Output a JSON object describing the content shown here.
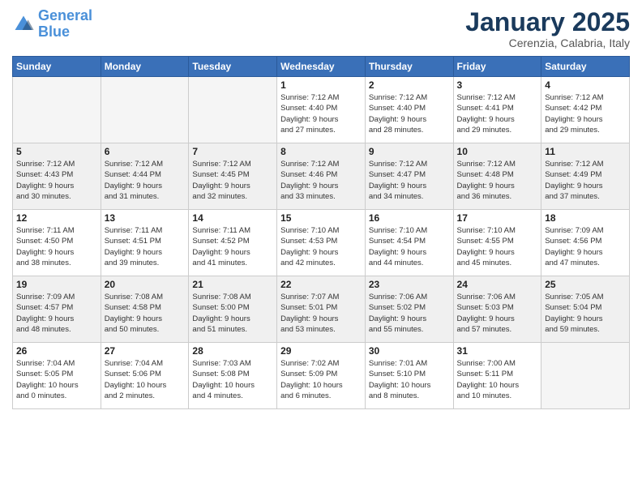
{
  "header": {
    "logo_line1": "General",
    "logo_line2": "Blue",
    "main_title": "January 2025",
    "subtitle": "Cerenzia, Calabria, Italy"
  },
  "weekdays": [
    "Sunday",
    "Monday",
    "Tuesday",
    "Wednesday",
    "Thursday",
    "Friday",
    "Saturday"
  ],
  "weeks": [
    [
      {
        "day": "",
        "info": ""
      },
      {
        "day": "",
        "info": ""
      },
      {
        "day": "",
        "info": ""
      },
      {
        "day": "1",
        "info": "Sunrise: 7:12 AM\nSunset: 4:40 PM\nDaylight: 9 hours\nand 27 minutes."
      },
      {
        "day": "2",
        "info": "Sunrise: 7:12 AM\nSunset: 4:40 PM\nDaylight: 9 hours\nand 28 minutes."
      },
      {
        "day": "3",
        "info": "Sunrise: 7:12 AM\nSunset: 4:41 PM\nDaylight: 9 hours\nand 29 minutes."
      },
      {
        "day": "4",
        "info": "Sunrise: 7:12 AM\nSunset: 4:42 PM\nDaylight: 9 hours\nand 29 minutes."
      }
    ],
    [
      {
        "day": "5",
        "info": "Sunrise: 7:12 AM\nSunset: 4:43 PM\nDaylight: 9 hours\nand 30 minutes."
      },
      {
        "day": "6",
        "info": "Sunrise: 7:12 AM\nSunset: 4:44 PM\nDaylight: 9 hours\nand 31 minutes."
      },
      {
        "day": "7",
        "info": "Sunrise: 7:12 AM\nSunset: 4:45 PM\nDaylight: 9 hours\nand 32 minutes."
      },
      {
        "day": "8",
        "info": "Sunrise: 7:12 AM\nSunset: 4:46 PM\nDaylight: 9 hours\nand 33 minutes."
      },
      {
        "day": "9",
        "info": "Sunrise: 7:12 AM\nSunset: 4:47 PM\nDaylight: 9 hours\nand 34 minutes."
      },
      {
        "day": "10",
        "info": "Sunrise: 7:12 AM\nSunset: 4:48 PM\nDaylight: 9 hours\nand 36 minutes."
      },
      {
        "day": "11",
        "info": "Sunrise: 7:12 AM\nSunset: 4:49 PM\nDaylight: 9 hours\nand 37 minutes."
      }
    ],
    [
      {
        "day": "12",
        "info": "Sunrise: 7:11 AM\nSunset: 4:50 PM\nDaylight: 9 hours\nand 38 minutes."
      },
      {
        "day": "13",
        "info": "Sunrise: 7:11 AM\nSunset: 4:51 PM\nDaylight: 9 hours\nand 39 minutes."
      },
      {
        "day": "14",
        "info": "Sunrise: 7:11 AM\nSunset: 4:52 PM\nDaylight: 9 hours\nand 41 minutes."
      },
      {
        "day": "15",
        "info": "Sunrise: 7:10 AM\nSunset: 4:53 PM\nDaylight: 9 hours\nand 42 minutes."
      },
      {
        "day": "16",
        "info": "Sunrise: 7:10 AM\nSunset: 4:54 PM\nDaylight: 9 hours\nand 44 minutes."
      },
      {
        "day": "17",
        "info": "Sunrise: 7:10 AM\nSunset: 4:55 PM\nDaylight: 9 hours\nand 45 minutes."
      },
      {
        "day": "18",
        "info": "Sunrise: 7:09 AM\nSunset: 4:56 PM\nDaylight: 9 hours\nand 47 minutes."
      }
    ],
    [
      {
        "day": "19",
        "info": "Sunrise: 7:09 AM\nSunset: 4:57 PM\nDaylight: 9 hours\nand 48 minutes."
      },
      {
        "day": "20",
        "info": "Sunrise: 7:08 AM\nSunset: 4:58 PM\nDaylight: 9 hours\nand 50 minutes."
      },
      {
        "day": "21",
        "info": "Sunrise: 7:08 AM\nSunset: 5:00 PM\nDaylight: 9 hours\nand 51 minutes."
      },
      {
        "day": "22",
        "info": "Sunrise: 7:07 AM\nSunset: 5:01 PM\nDaylight: 9 hours\nand 53 minutes."
      },
      {
        "day": "23",
        "info": "Sunrise: 7:06 AM\nSunset: 5:02 PM\nDaylight: 9 hours\nand 55 minutes."
      },
      {
        "day": "24",
        "info": "Sunrise: 7:06 AM\nSunset: 5:03 PM\nDaylight: 9 hours\nand 57 minutes."
      },
      {
        "day": "25",
        "info": "Sunrise: 7:05 AM\nSunset: 5:04 PM\nDaylight: 9 hours\nand 59 minutes."
      }
    ],
    [
      {
        "day": "26",
        "info": "Sunrise: 7:04 AM\nSunset: 5:05 PM\nDaylight: 10 hours\nand 0 minutes."
      },
      {
        "day": "27",
        "info": "Sunrise: 7:04 AM\nSunset: 5:06 PM\nDaylight: 10 hours\nand 2 minutes."
      },
      {
        "day": "28",
        "info": "Sunrise: 7:03 AM\nSunset: 5:08 PM\nDaylight: 10 hours\nand 4 minutes."
      },
      {
        "day": "29",
        "info": "Sunrise: 7:02 AM\nSunset: 5:09 PM\nDaylight: 10 hours\nand 6 minutes."
      },
      {
        "day": "30",
        "info": "Sunrise: 7:01 AM\nSunset: 5:10 PM\nDaylight: 10 hours\nand 8 minutes."
      },
      {
        "day": "31",
        "info": "Sunrise: 7:00 AM\nSunset: 5:11 PM\nDaylight: 10 hours\nand 10 minutes."
      },
      {
        "day": "",
        "info": ""
      }
    ]
  ]
}
